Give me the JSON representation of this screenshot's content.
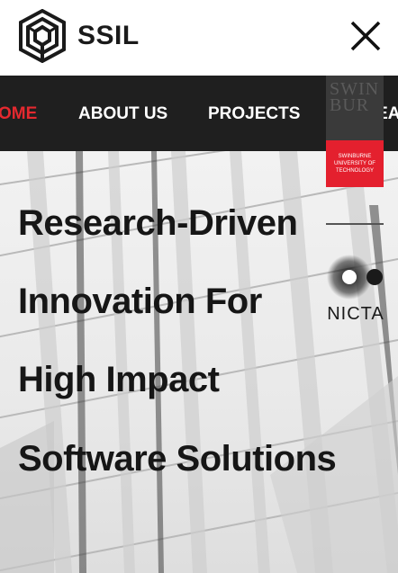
{
  "header": {
    "logo_text": "SSIL",
    "logo_icon": "hexagon-cube-logo-icon",
    "close_icon": "close-icon"
  },
  "nav": {
    "items": [
      {
        "label": "OME",
        "active": true
      },
      {
        "label": "ABOUT US",
        "active": false
      },
      {
        "label": "PROJECTS",
        "active": false
      },
      {
        "label": "RESEA",
        "active": false
      }
    ],
    "active_color": "#e4292f"
  },
  "hero": {
    "headline": [
      "Research-Driven",
      "Innovation For",
      "High Impact",
      "Software Solutions"
    ]
  },
  "partners": {
    "swinburne": {
      "top_text": "SWIN BUR",
      "red_text": "SWINBURNE UNIVERSITY OF TECHNOLOGY",
      "color": "#e4202e"
    },
    "nicta": {
      "text": "NICTA"
    }
  }
}
